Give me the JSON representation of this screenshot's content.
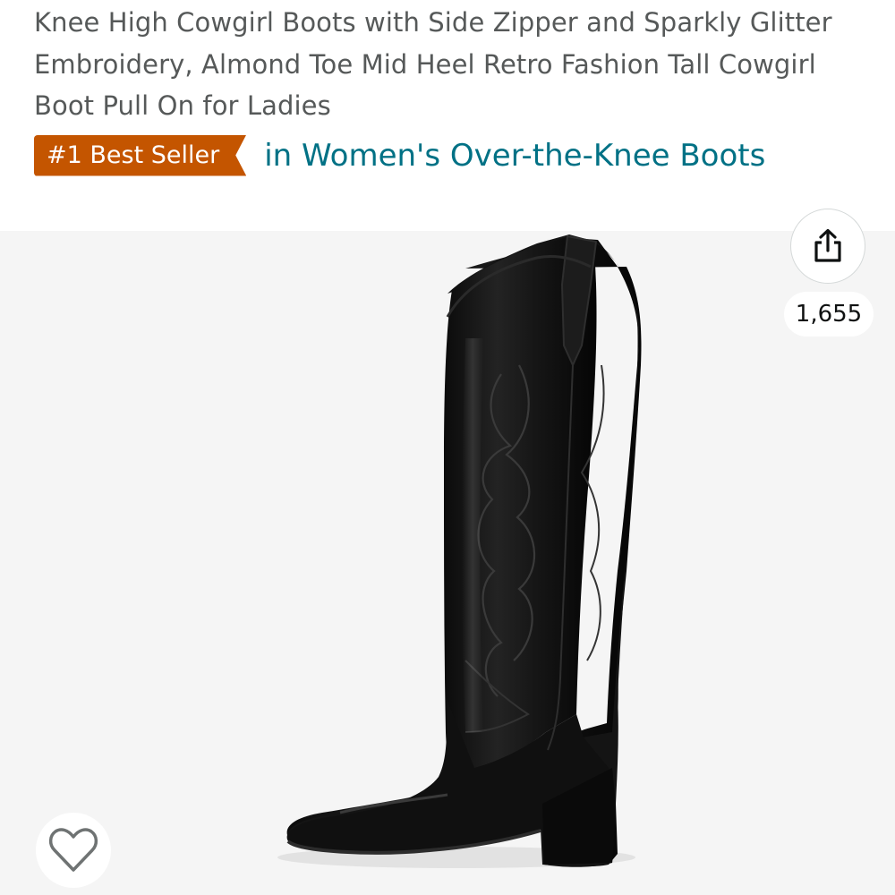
{
  "product": {
    "title": "Knee High Cowgirl Boots with Side Zipper and Sparkly Glitter Embroidery, Almond Toe Mid Heel Retro Fashion Tall Cowgirl Boot Pull On for Ladies"
  },
  "best_seller": {
    "badge_label": "#1 Best Seller",
    "category_link": "in Women's Over-the-Knee Boots"
  },
  "gallery": {
    "image_alt": "Black knee-high western boot with embroidery",
    "share_icon": "share-icon",
    "share_count": "1,655",
    "wishlist_icon": "heart-outline-icon"
  },
  "colors": {
    "badge_bg": "#c45500",
    "link": "#007185",
    "title_text": "#565959",
    "gallery_bg": "#f5f5f5"
  }
}
